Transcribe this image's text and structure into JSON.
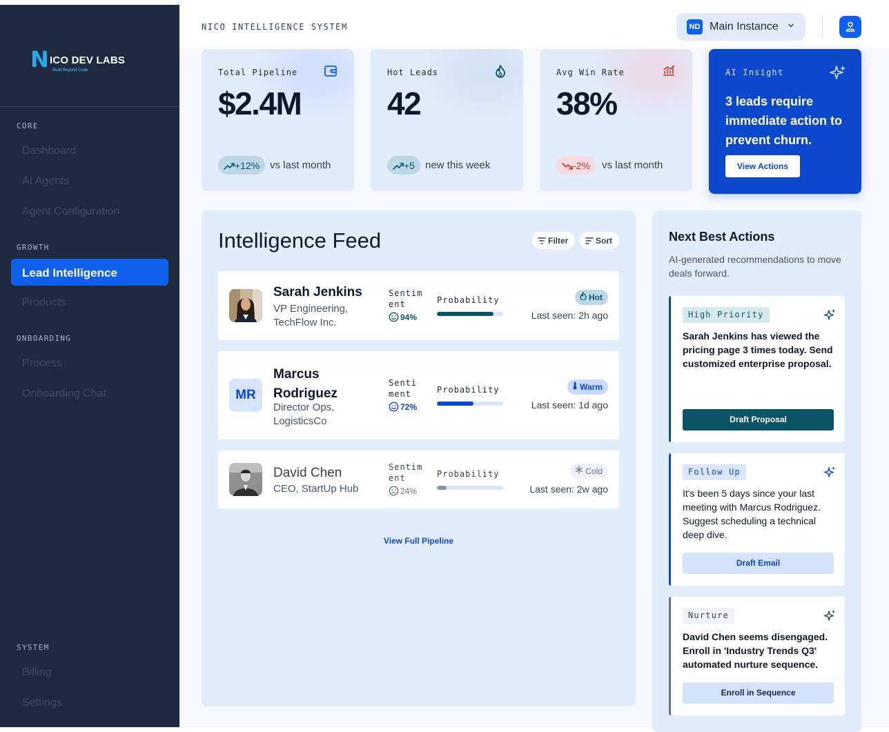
{
  "sidebar": {
    "logo_n": "N",
    "logo_text": "ICO DEV LABS",
    "logo_tagline": "Build Beyond Code",
    "sections": {
      "core": "CORE",
      "growth": "GROWTH",
      "onboarding": "ONBOARDING",
      "system": "SYSTEM"
    },
    "items": {
      "dashboard": "Dashboard",
      "ai_agents": "AI Agents",
      "agent_config": "Agent Configuration",
      "lead_intel": "Lead Intelligence",
      "products": "Products",
      "process": "Process",
      "onboarding_chat": "Onboarding Chat",
      "billing": "Billing",
      "settings": "Settings"
    },
    "active_item": "Lead Intelligence"
  },
  "header": {
    "brand": "NICO INTELLIGENCE SYSTEM",
    "instance_badge": "ND",
    "instance_label": "Main Instance"
  },
  "kpis": {
    "pipeline": {
      "label": "Total Pipeline",
      "value": "$2.4M",
      "change": "+12%",
      "note": "vs last month",
      "icon": "wallet-icon"
    },
    "hot_leads": {
      "label": "Hot Leads",
      "value": "42",
      "change": "+5",
      "note": "new this week",
      "icon": "flame-icon"
    },
    "win_rate": {
      "label": "Avg Win Rate",
      "value": "38%",
      "change": "-2%",
      "note": "vs last month",
      "icon": "chart-icon"
    }
  },
  "insight": {
    "label": "AI Insight",
    "text": "3 leads require immediate action to prevent churn.",
    "button": "View Actions"
  },
  "feed": {
    "title": "Intelligence Feed",
    "filter_label": "Filter",
    "sort_label": "Sort",
    "sentiment_label_a": "Sentim\nent",
    "sentiment_label_b": "Senti\nment",
    "probability_label": "Probability",
    "leads": [
      {
        "name": "Sarah Jenkins",
        "role": "VP Engineering, TechFlow Inc.",
        "sentiment": "94%",
        "probability": 0.85,
        "status": "Hot",
        "last_seen": "Last seen: 2h ago"
      },
      {
        "name": "Marcus Rodriguez",
        "initials": "MR",
        "role": "Director Ops, LogisticsCo",
        "sentiment": "72%",
        "probability": 0.55,
        "status": "Warm",
        "last_seen": "Last seen: 1d ago"
      },
      {
        "name": "David Chen",
        "role": "CEO, StartUp Hub",
        "sentiment": "24%",
        "probability": 0.15,
        "status": "Cold",
        "last_seen": "Last seen: 2w ago"
      }
    ],
    "view_full": "View Full Pipeline"
  },
  "nba": {
    "title": "Next Best Actions",
    "subtitle": "AI-generated recommendations to move deals forward.",
    "actions": [
      {
        "tag": "High Priority",
        "body": "Sarah Jenkins has viewed the pricing page 3 times today. Send customized enterprise proposal.",
        "button": "Draft Proposal"
      },
      {
        "tag": "Follow Up",
        "body": "It's been 5 days since your last meeting with Marcus Rodriguez. Suggest scheduling a technical deep dive.",
        "button": "Draft Email"
      },
      {
        "tag": "Nurture",
        "body": "David Chen seems disengaged. Enroll in 'Industry Trends Q3' automated nurture sequence.",
        "button": "Enroll in Sequence"
      }
    ]
  },
  "colors": {
    "accent": "#1060ee",
    "sidebar": "#1f2a40",
    "teal": "#0b5566",
    "danger": "#c0392b",
    "card_bg": "#e3ecfc"
  }
}
